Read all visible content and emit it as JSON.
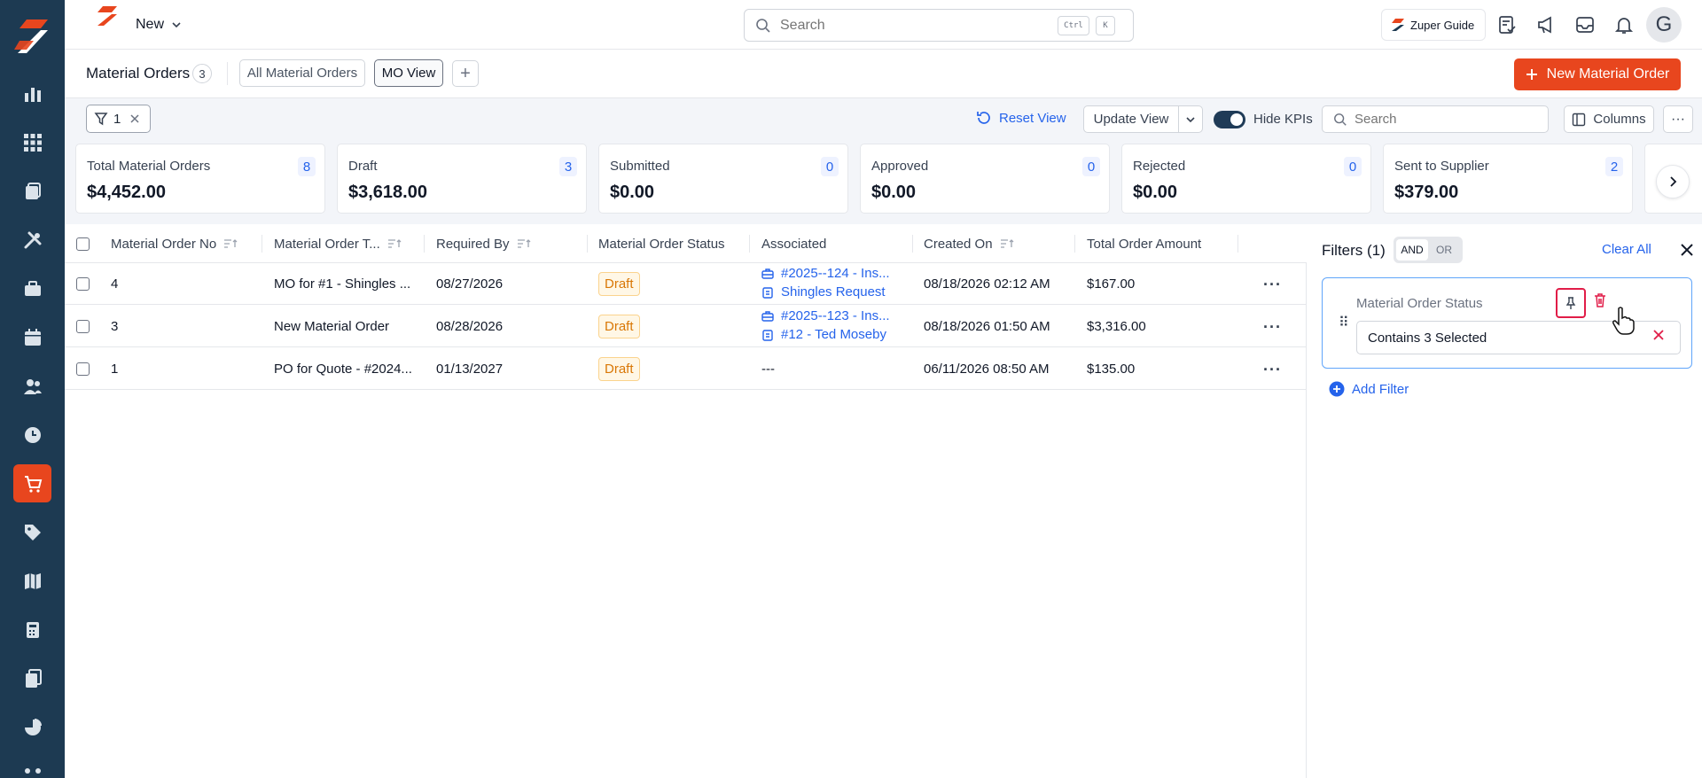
{
  "topbar": {
    "new_label": "New",
    "search_placeholder": "Search",
    "kbd_ctrl": "Ctrl",
    "kbd_k": "K",
    "guide_label": "Zuper Guide",
    "avatar_initial": "G"
  },
  "sidebar": {
    "items": [
      {
        "icon": "bar-chart-icon"
      },
      {
        "icon": "grid-icon"
      },
      {
        "icon": "briefcase-icon"
      },
      {
        "icon": "tools-icon"
      },
      {
        "icon": "toolbox-icon"
      },
      {
        "icon": "calendar-icon"
      },
      {
        "icon": "users-icon"
      },
      {
        "icon": "clock-icon"
      },
      {
        "icon": "cart-icon",
        "active": true
      },
      {
        "icon": "tag-icon"
      },
      {
        "icon": "map-icon"
      },
      {
        "icon": "calculator-icon"
      },
      {
        "icon": "documents-icon"
      },
      {
        "icon": "pie-chart-icon"
      },
      {
        "icon": "flow-icon"
      }
    ],
    "accent": "#e8461e",
    "background": "#1d3a52"
  },
  "viewbar": {
    "title": "Material Orders",
    "count": "3",
    "tabs": [
      {
        "label": "All Material Orders",
        "active": false
      },
      {
        "label": "MO View",
        "active": true
      }
    ],
    "add_tab": "+",
    "new_button": "New Material Order"
  },
  "toolbar": {
    "filter_count": "1",
    "reset_view": "Reset View",
    "update_view": "Update View",
    "hide_kpis": "Hide KPIs",
    "hide_kpis_on": true,
    "search_placeholder": "Search",
    "columns": "Columns",
    "more": "···"
  },
  "kpis": [
    {
      "label": "Total Material Orders",
      "count": "8",
      "value": "$4,452.00"
    },
    {
      "label": "Draft",
      "count": "3",
      "value": "$3,618.00"
    },
    {
      "label": "Submitted",
      "count": "0",
      "value": "$0.00"
    },
    {
      "label": "Approved",
      "count": "0",
      "value": "$0.00"
    },
    {
      "label": "Rejected",
      "count": "0",
      "value": "$0.00"
    },
    {
      "label": "Sent to Supplier",
      "count": "2",
      "value": "$379.00"
    }
  ],
  "table": {
    "headers": [
      "Material Order No",
      "Material Order T...",
      "Required By",
      "Material Order Status",
      "Associated",
      "Created On",
      "Total Order Amount"
    ],
    "rows": [
      {
        "no": "4",
        "title": "MO for #1 - Shingles ...",
        "required_by": "08/27/2026",
        "status": "Draft",
        "assoc_job": "#2025--124 - Ins...",
        "assoc_request": "Shingles Request",
        "created_on": "08/18/2026 02:12 AM",
        "amount": "$167.00"
      },
      {
        "no": "3",
        "title": "New Material Order",
        "required_by": "08/28/2026",
        "status": "Draft",
        "assoc_job": "#2025--123 - Ins...",
        "assoc_request": "#12 - Ted Moseby",
        "created_on": "08/18/2026 01:50 AM",
        "amount": "$3,316.00"
      },
      {
        "no": "1",
        "title": "PO for Quote - #2024...",
        "required_by": "01/13/2027",
        "status": "Draft",
        "assoc_none": "---",
        "created_on": "06/11/2026 08:50 AM",
        "amount": "$135.00"
      }
    ],
    "row_more": "···"
  },
  "filters": {
    "title": "Filters (1)",
    "and": "AND",
    "or": "OR",
    "clear_all": "Clear All",
    "card": {
      "field": "Material Order Status",
      "value": "Contains 3 Selected"
    },
    "add_filter": "Add Filter",
    "link_color": "#2563eb"
  }
}
